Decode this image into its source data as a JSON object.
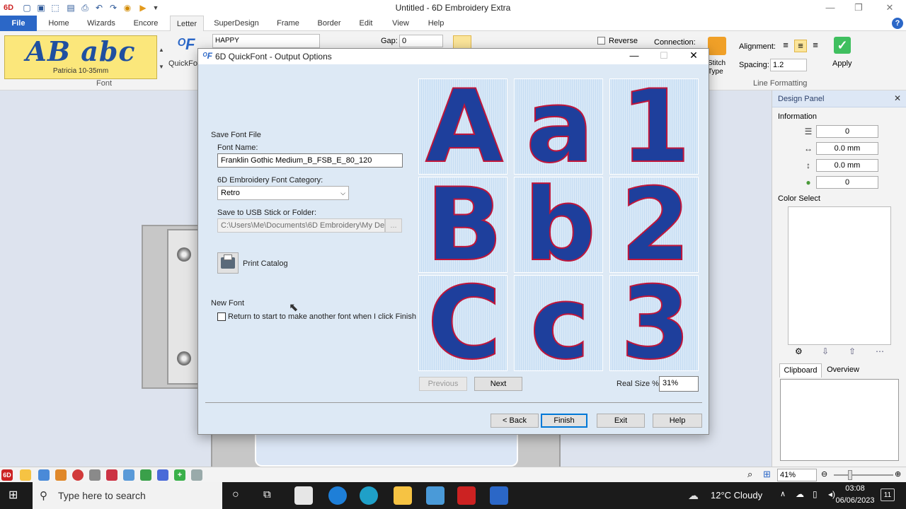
{
  "app": {
    "title": "Untitled - 6D Embroidery Extra",
    "menu_tabs": [
      "File",
      "Home",
      "Wizards",
      "Encore",
      "Letter",
      "SuperDesign",
      "Frame",
      "Border",
      "Edit",
      "View",
      "Help"
    ],
    "active_tab": "Letter"
  },
  "ribbon": {
    "font_sample": "AB abc",
    "font_size_name": "Patricia 10-35mm",
    "font_group_label": "Font",
    "quickfont_label": "QuickFo",
    "text_value": "HAPPY",
    "gap_label": "Gap:",
    "gap_value": "0",
    "reverse_label": "Reverse",
    "connection_label": "Connection:",
    "stitch_type_label": "Stitch Type",
    "alignment_label": "Alignment:",
    "spacing_label": "Spacing:",
    "spacing_value": "1.2",
    "apply_label": "Apply",
    "line_formatting_label": "Line Formatting"
  },
  "design_panel": {
    "title": "Design Panel",
    "information_label": "Information",
    "fields": [
      "0",
      "0.0 mm",
      "0.0 mm",
      "0"
    ],
    "color_select_label": "Color Select",
    "tabs": [
      "Clipboard",
      "Overview"
    ]
  },
  "dialog": {
    "title": "6D QuickFont - Output Options",
    "save_font_file_label": "Save Font File",
    "font_name_label": "Font Name:",
    "font_name_value": "Franklin Gothic Medium_B_FSB_E_80_120",
    "category_label": "6D Embroidery Font Category:",
    "category_value": "Retro",
    "save_to_label": "Save to USB Stick or Folder:",
    "save_to_value": "C:\\Users\\Me\\Documents\\6D Embroidery\\My Design",
    "browse_label": "...",
    "print_catalog_label": "Print Catalog",
    "new_font_label": "New Font",
    "return_checkbox_label": "Return to start to make another font when I click Finish",
    "preview_letters": [
      "A",
      "a",
      "1",
      "B",
      "b",
      "2",
      "C",
      "c",
      "3"
    ],
    "previous_label": "Previous",
    "next_label": "Next",
    "real_size_label": "Real Size %",
    "real_size_value": "31%",
    "back_label": "< Back",
    "finish_label": "Finish",
    "exit_label": "Exit",
    "help_label": "Help"
  },
  "statusbar": {
    "zoom_value": "41%"
  },
  "taskbar": {
    "search_placeholder": "Type here to search",
    "weather": "12°C  Cloudy",
    "time": "03:08",
    "date": "06/06/2023",
    "notification_count": "11"
  },
  "colors": {
    "accent": "#2b67c7",
    "letter_fill": "#1e3f9c",
    "letter_outline": "#c0153a",
    "dialog_body": "#dde9f5"
  }
}
